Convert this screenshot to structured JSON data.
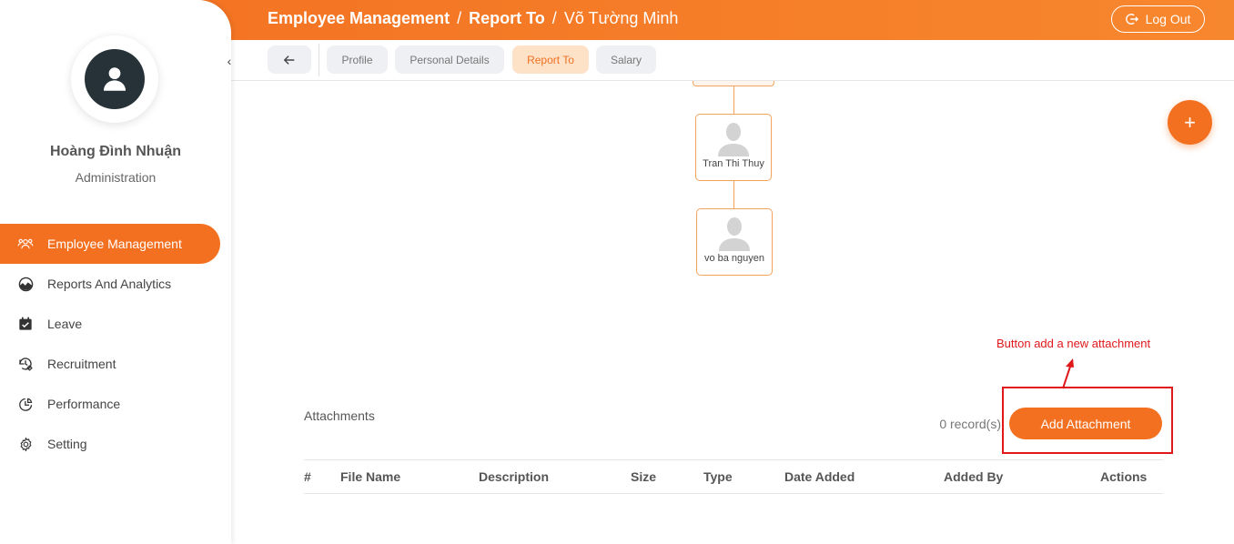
{
  "header": {
    "breadcrumb_section": "Employee Management",
    "breadcrumb_separator_1": "/",
    "breadcrumb_page": "Report To",
    "breadcrumb_separator_2": "/",
    "employee_name": "Võ Tường Minh",
    "logout_label": "Log Out"
  },
  "sidebar": {
    "user_name": "Hoàng Đình Nhuận",
    "user_role": "Administration",
    "collapse_glyph": "‹",
    "items": [
      {
        "label": "Employee Management",
        "icon": "users-icon",
        "active": true
      },
      {
        "label": "Reports And Analytics",
        "icon": "chart-pie-icon",
        "active": false
      },
      {
        "label": "Leave",
        "icon": "calendar-check-icon",
        "active": false
      },
      {
        "label": "Recruitment",
        "icon": "recruitment-icon",
        "active": false
      },
      {
        "label": "Performance",
        "icon": "performance-icon",
        "active": false
      },
      {
        "label": "Setting",
        "icon": "gear-icon",
        "active": false
      }
    ]
  },
  "tabs": {
    "items": [
      {
        "label": "Profile",
        "active": false
      },
      {
        "label": "Personal Details",
        "active": false
      },
      {
        "label": "Report To",
        "active": true
      },
      {
        "label": "Salary",
        "active": false
      }
    ]
  },
  "org_chart": {
    "nodes": [
      {
        "name": "Tran Thi Thuy"
      },
      {
        "name": "vo ba nguyen"
      }
    ]
  },
  "fab_label": "+",
  "annotation": {
    "text": "Button add a new attachment"
  },
  "attachments": {
    "title": "Attachments",
    "record_count": "0 record(s)",
    "add_button_label": "Add Attachment",
    "columns": [
      "#",
      "File Name",
      "Description",
      "Size",
      "Type",
      "Date Added",
      "Added By",
      "Actions"
    ]
  },
  "colors": {
    "accent": "#f37021",
    "annotation": "#e0181b",
    "active_tab_bg": "#fde2c8"
  }
}
